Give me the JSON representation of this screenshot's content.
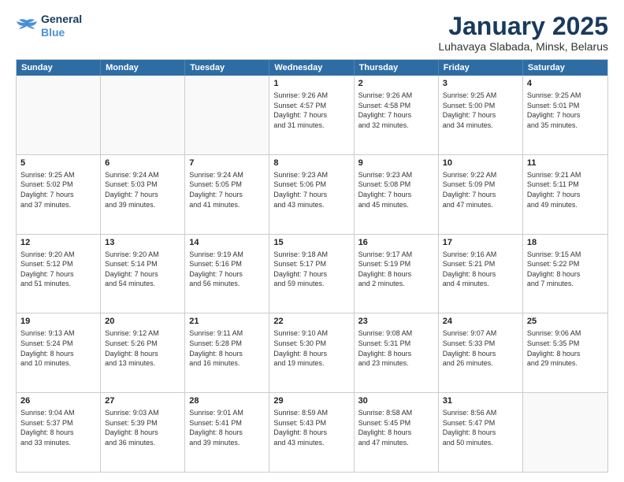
{
  "logo": {
    "line1": "General",
    "line2": "Blue"
  },
  "title": "January 2025",
  "subtitle": "Luhavaya Slabada, Minsk, Belarus",
  "header_days": [
    "Sunday",
    "Monday",
    "Tuesday",
    "Wednesday",
    "Thursday",
    "Friday",
    "Saturday"
  ],
  "weeks": [
    [
      {
        "day": "",
        "info": ""
      },
      {
        "day": "",
        "info": ""
      },
      {
        "day": "",
        "info": ""
      },
      {
        "day": "1",
        "info": "Sunrise: 9:26 AM\nSunset: 4:57 PM\nDaylight: 7 hours\nand 31 minutes."
      },
      {
        "day": "2",
        "info": "Sunrise: 9:26 AM\nSunset: 4:58 PM\nDaylight: 7 hours\nand 32 minutes."
      },
      {
        "day": "3",
        "info": "Sunrise: 9:25 AM\nSunset: 5:00 PM\nDaylight: 7 hours\nand 34 minutes."
      },
      {
        "day": "4",
        "info": "Sunrise: 9:25 AM\nSunset: 5:01 PM\nDaylight: 7 hours\nand 35 minutes."
      }
    ],
    [
      {
        "day": "5",
        "info": "Sunrise: 9:25 AM\nSunset: 5:02 PM\nDaylight: 7 hours\nand 37 minutes."
      },
      {
        "day": "6",
        "info": "Sunrise: 9:24 AM\nSunset: 5:03 PM\nDaylight: 7 hours\nand 39 minutes."
      },
      {
        "day": "7",
        "info": "Sunrise: 9:24 AM\nSunset: 5:05 PM\nDaylight: 7 hours\nand 41 minutes."
      },
      {
        "day": "8",
        "info": "Sunrise: 9:23 AM\nSunset: 5:06 PM\nDaylight: 7 hours\nand 43 minutes."
      },
      {
        "day": "9",
        "info": "Sunrise: 9:23 AM\nSunset: 5:08 PM\nDaylight: 7 hours\nand 45 minutes."
      },
      {
        "day": "10",
        "info": "Sunrise: 9:22 AM\nSunset: 5:09 PM\nDaylight: 7 hours\nand 47 minutes."
      },
      {
        "day": "11",
        "info": "Sunrise: 9:21 AM\nSunset: 5:11 PM\nDaylight: 7 hours\nand 49 minutes."
      }
    ],
    [
      {
        "day": "12",
        "info": "Sunrise: 9:20 AM\nSunset: 5:12 PM\nDaylight: 7 hours\nand 51 minutes."
      },
      {
        "day": "13",
        "info": "Sunrise: 9:20 AM\nSunset: 5:14 PM\nDaylight: 7 hours\nand 54 minutes."
      },
      {
        "day": "14",
        "info": "Sunrise: 9:19 AM\nSunset: 5:16 PM\nDaylight: 7 hours\nand 56 minutes."
      },
      {
        "day": "15",
        "info": "Sunrise: 9:18 AM\nSunset: 5:17 PM\nDaylight: 7 hours\nand 59 minutes."
      },
      {
        "day": "16",
        "info": "Sunrise: 9:17 AM\nSunset: 5:19 PM\nDaylight: 8 hours\nand 2 minutes."
      },
      {
        "day": "17",
        "info": "Sunrise: 9:16 AM\nSunset: 5:21 PM\nDaylight: 8 hours\nand 4 minutes."
      },
      {
        "day": "18",
        "info": "Sunrise: 9:15 AM\nSunset: 5:22 PM\nDaylight: 8 hours\nand 7 minutes."
      }
    ],
    [
      {
        "day": "19",
        "info": "Sunrise: 9:13 AM\nSunset: 5:24 PM\nDaylight: 8 hours\nand 10 minutes."
      },
      {
        "day": "20",
        "info": "Sunrise: 9:12 AM\nSunset: 5:26 PM\nDaylight: 8 hours\nand 13 minutes."
      },
      {
        "day": "21",
        "info": "Sunrise: 9:11 AM\nSunset: 5:28 PM\nDaylight: 8 hours\nand 16 minutes."
      },
      {
        "day": "22",
        "info": "Sunrise: 9:10 AM\nSunset: 5:30 PM\nDaylight: 8 hours\nand 19 minutes."
      },
      {
        "day": "23",
        "info": "Sunrise: 9:08 AM\nSunset: 5:31 PM\nDaylight: 8 hours\nand 23 minutes."
      },
      {
        "day": "24",
        "info": "Sunrise: 9:07 AM\nSunset: 5:33 PM\nDaylight: 8 hours\nand 26 minutes."
      },
      {
        "day": "25",
        "info": "Sunrise: 9:06 AM\nSunset: 5:35 PM\nDaylight: 8 hours\nand 29 minutes."
      }
    ],
    [
      {
        "day": "26",
        "info": "Sunrise: 9:04 AM\nSunset: 5:37 PM\nDaylight: 8 hours\nand 33 minutes."
      },
      {
        "day": "27",
        "info": "Sunrise: 9:03 AM\nSunset: 5:39 PM\nDaylight: 8 hours\nand 36 minutes."
      },
      {
        "day": "28",
        "info": "Sunrise: 9:01 AM\nSunset: 5:41 PM\nDaylight: 8 hours\nand 39 minutes."
      },
      {
        "day": "29",
        "info": "Sunrise: 8:59 AM\nSunset: 5:43 PM\nDaylight: 8 hours\nand 43 minutes."
      },
      {
        "day": "30",
        "info": "Sunrise: 8:58 AM\nSunset: 5:45 PM\nDaylight: 8 hours\nand 47 minutes."
      },
      {
        "day": "31",
        "info": "Sunrise: 8:56 AM\nSunset: 5:47 PM\nDaylight: 8 hours\nand 50 minutes."
      },
      {
        "day": "",
        "info": ""
      }
    ]
  ]
}
